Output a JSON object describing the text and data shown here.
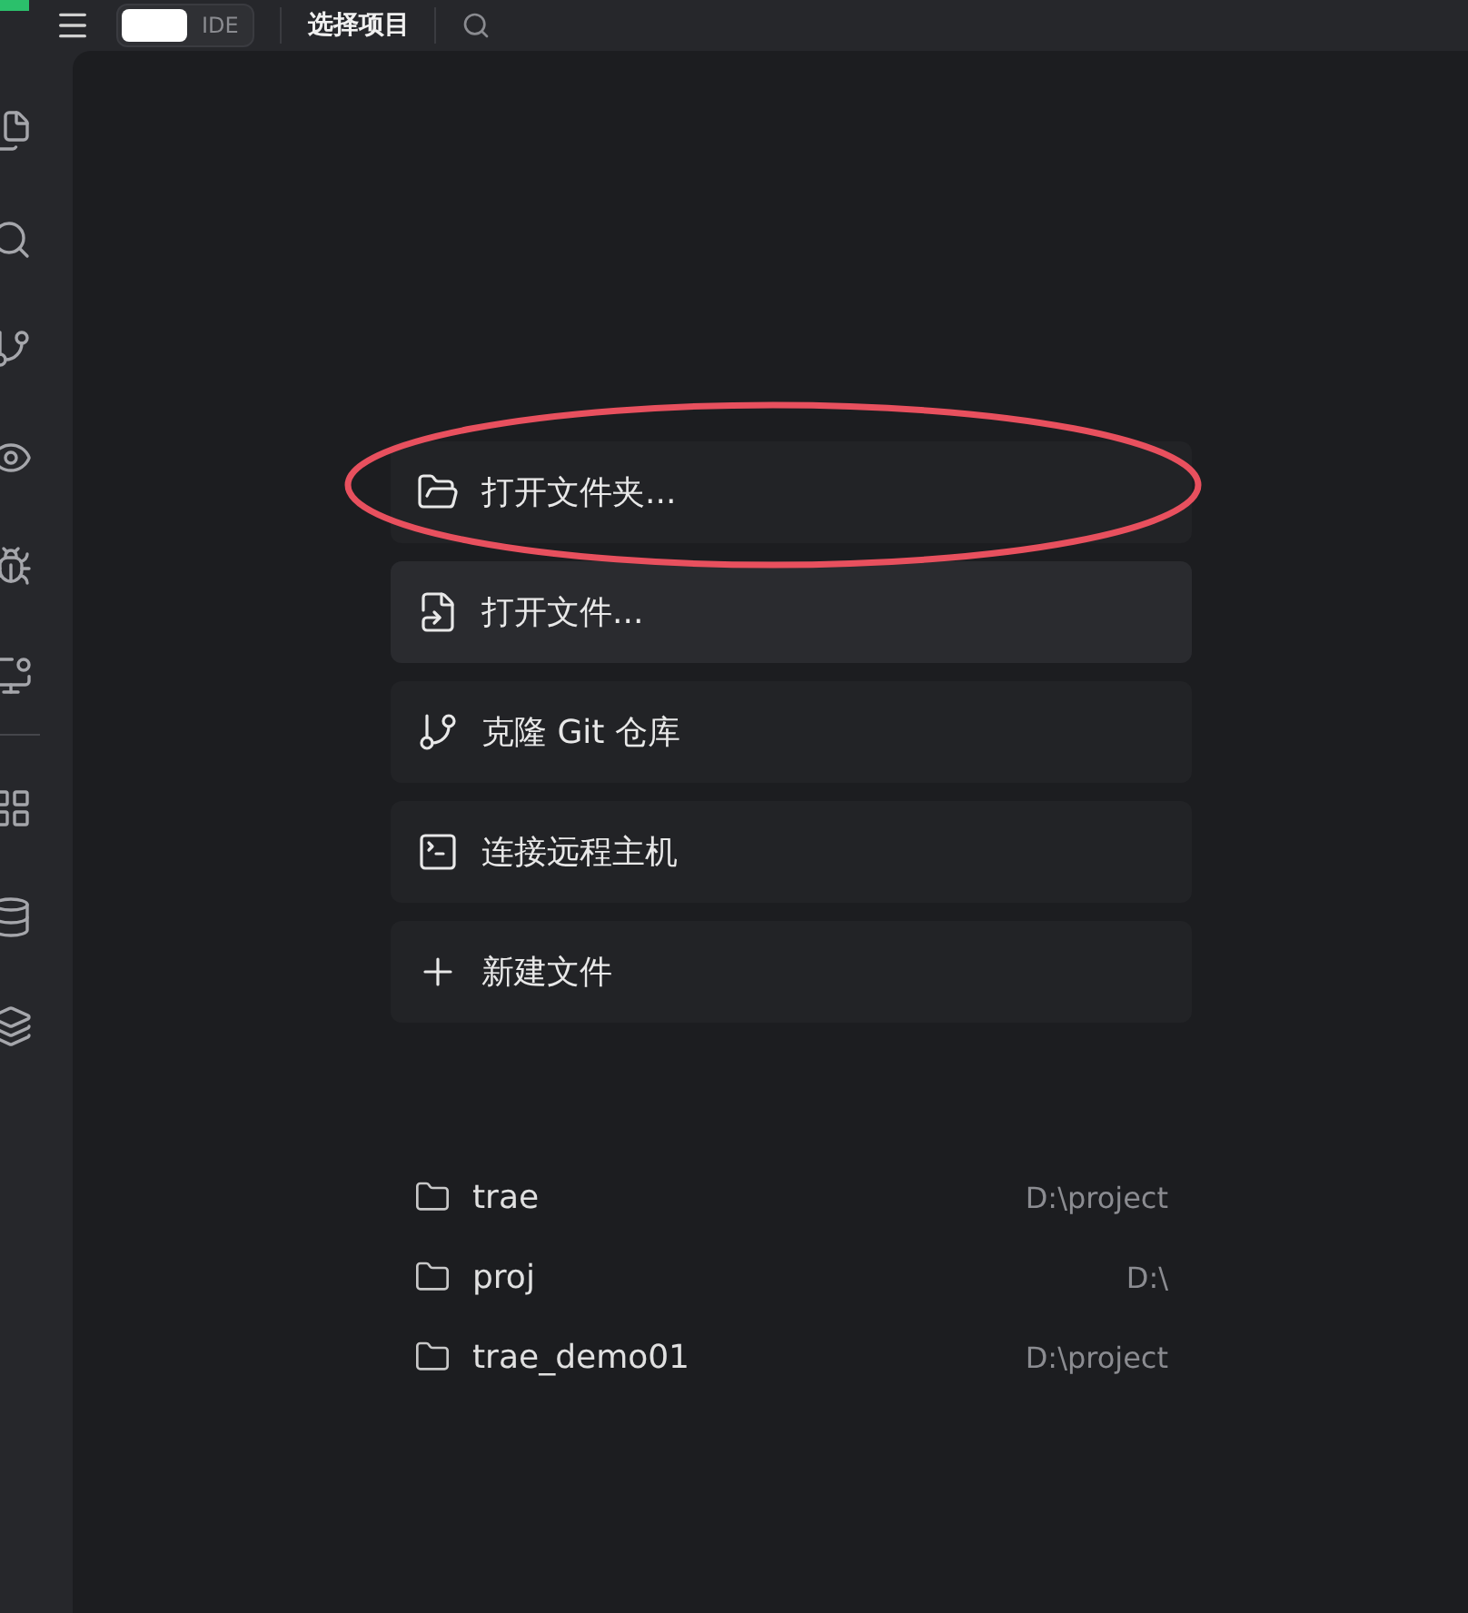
{
  "top_bar": {
    "badge": "IDE",
    "title": "选择项目"
  },
  "activity_bar": {
    "items": [
      {
        "kind": "files",
        "selected": false
      },
      {
        "kind": "search",
        "selected": false
      },
      {
        "kind": "branch",
        "selected": false
      },
      {
        "kind": "eye",
        "selected": false
      },
      {
        "kind": "bug",
        "selected": false
      },
      {
        "kind": "monitor",
        "selected": false
      },
      {
        "kind": "divider",
        "selected": false
      },
      {
        "kind": "grid",
        "selected": false
      },
      {
        "kind": "database",
        "selected": false
      },
      {
        "kind": "layers",
        "selected": false
      }
    ]
  },
  "actions": [
    {
      "kind": "folder",
      "label": "打开文件夹...",
      "hovered": false,
      "highlighted": true
    },
    {
      "kind": "file",
      "label": "打开文件...",
      "hovered": true,
      "highlighted": false
    },
    {
      "kind": "git",
      "label": "克隆 Git 仓库",
      "hovered": false,
      "highlighted": false
    },
    {
      "kind": "terminal",
      "label": "连接远程主机",
      "hovered": false,
      "highlighted": false
    },
    {
      "kind": "plus",
      "label": "新建文件",
      "hovered": false,
      "highlighted": false
    }
  ],
  "recent_projects": [
    {
      "name": "trae",
      "path": "D:\\project"
    },
    {
      "name": "proj",
      "path": "D:\\"
    },
    {
      "name": "trae_demo01",
      "path": "D:\\project"
    }
  ]
}
